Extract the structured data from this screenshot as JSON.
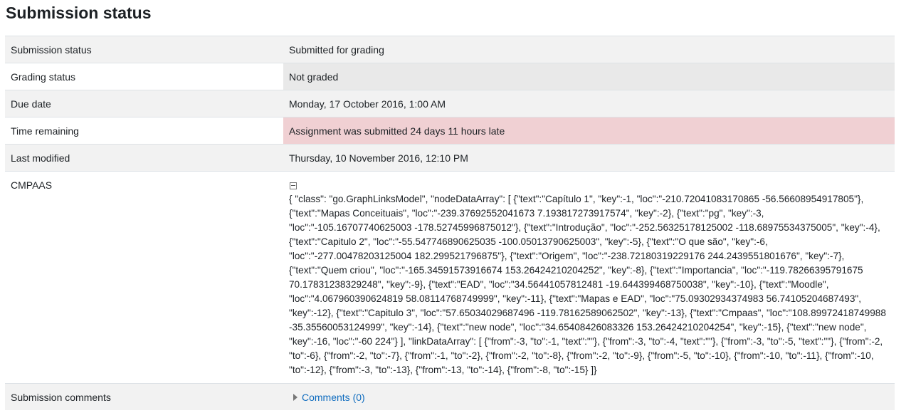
{
  "heading": "Submission status",
  "rows": [
    {
      "label": "Submission status",
      "value": "Submitted for grading"
    },
    {
      "label": "Grading status",
      "value": "Not graded"
    },
    {
      "label": "Due date",
      "value": "Monday, 17 October 2016, 1:00 AM"
    },
    {
      "label": "Time remaining",
      "value": "Assignment was submitted 24 days 11 hours late"
    },
    {
      "label": "Last modified",
      "value": "Thursday, 10 November 2016, 12:10 PM"
    },
    {
      "label": "CMPAAS",
      "value": "{ \"class\": \"go.GraphLinksModel\", \"nodeDataArray\": [ {\"text\":\"Capítulo 1\", \"key\":-1, \"loc\":\"-210.72041083170865 -56.56608954917805\"}, {\"text\":\"Mapas Conceituais\", \"loc\":\"-239.37692552041673 7.193817273917574\", \"key\":-2}, {\"text\":\"pg\", \"key\":-3, \"loc\":\"-105.16707740625003 -178.52745996875012\"}, {\"text\":\"Introdução\", \"loc\":\"-252.56325178125002 -118.68975534375005\", \"key\":-4}, {\"text\":\"Capitulo 2\", \"loc\":\"-55.547746890625035 -100.05013790625003\", \"key\":-5}, {\"text\":\"O que são\", \"key\":-6, \"loc\":\"-277.00478203125004 182.299521796875\"}, {\"text\":\"Origem\", \"loc\":\"-238.72180319229176 244.2439551801676\", \"key\":-7}, {\"text\":\"Quem criou\", \"loc\":\"-165.34591573916674 153.26424210204252\", \"key\":-8}, {\"text\":\"Importancia\", \"loc\":\"-119.78266395791675 70.17831238329248\", \"key\":-9}, {\"text\":\"EAD\", \"loc\":\"34.56441057812481 -19.644399468750038\", \"key\":-10}, {\"text\":\"Moodle\", \"loc\":\"4.067960390624819 58.08114768749999\", \"key\":-11}, {\"text\":\"Mapas e EAD\", \"loc\":\"75.09302934374983 56.74105204687493\", \"key\":-12}, {\"text\":\"Capitulo 3\", \"loc\":\"57.65034029687496 -119.78162589062502\", \"key\":-13}, {\"text\":\"Cmpaas\", \"loc\":\"108.89972418749988 -35.35560053124999\", \"key\":-14}, {\"text\":\"new node\", \"loc\":\"34.65408426083326 153.26424210204254\", \"key\":-15}, {\"text\":\"new node\", \"key\":-16, \"loc\":\"-60 224\"} ], \"linkDataArray\": [ {\"from\":-3, \"to\":-1, \"text\":\"\"}, {\"from\":-3, \"to\":-4, \"text\":\"\"}, {\"from\":-3, \"to\":-5, \"text\":\"\"}, {\"from\":-2, \"to\":-6}, {\"from\":-2, \"to\":-7}, {\"from\":-1, \"to\":-2}, {\"from\":-2, \"to\":-8}, {\"from\":-2, \"to\":-9}, {\"from\":-5, \"to\":-10}, {\"from\":-10, \"to\":-11}, {\"from\":-10, \"to\":-12}, {\"from\":-3, \"to\":-13}, {\"from\":-13, \"to\":-14}, {\"from\":-8, \"to\":-15} ]}"
    },
    {
      "label": "Submission comments",
      "value": "Comments (0)"
    }
  ],
  "colors": {
    "late_background": "#f0d0d3",
    "row_stripe": "#f2f2f2",
    "link": "#0f6cbf"
  },
  "icons": {
    "collapse": "minus-square-icon",
    "expand": "caret-right-icon"
  }
}
